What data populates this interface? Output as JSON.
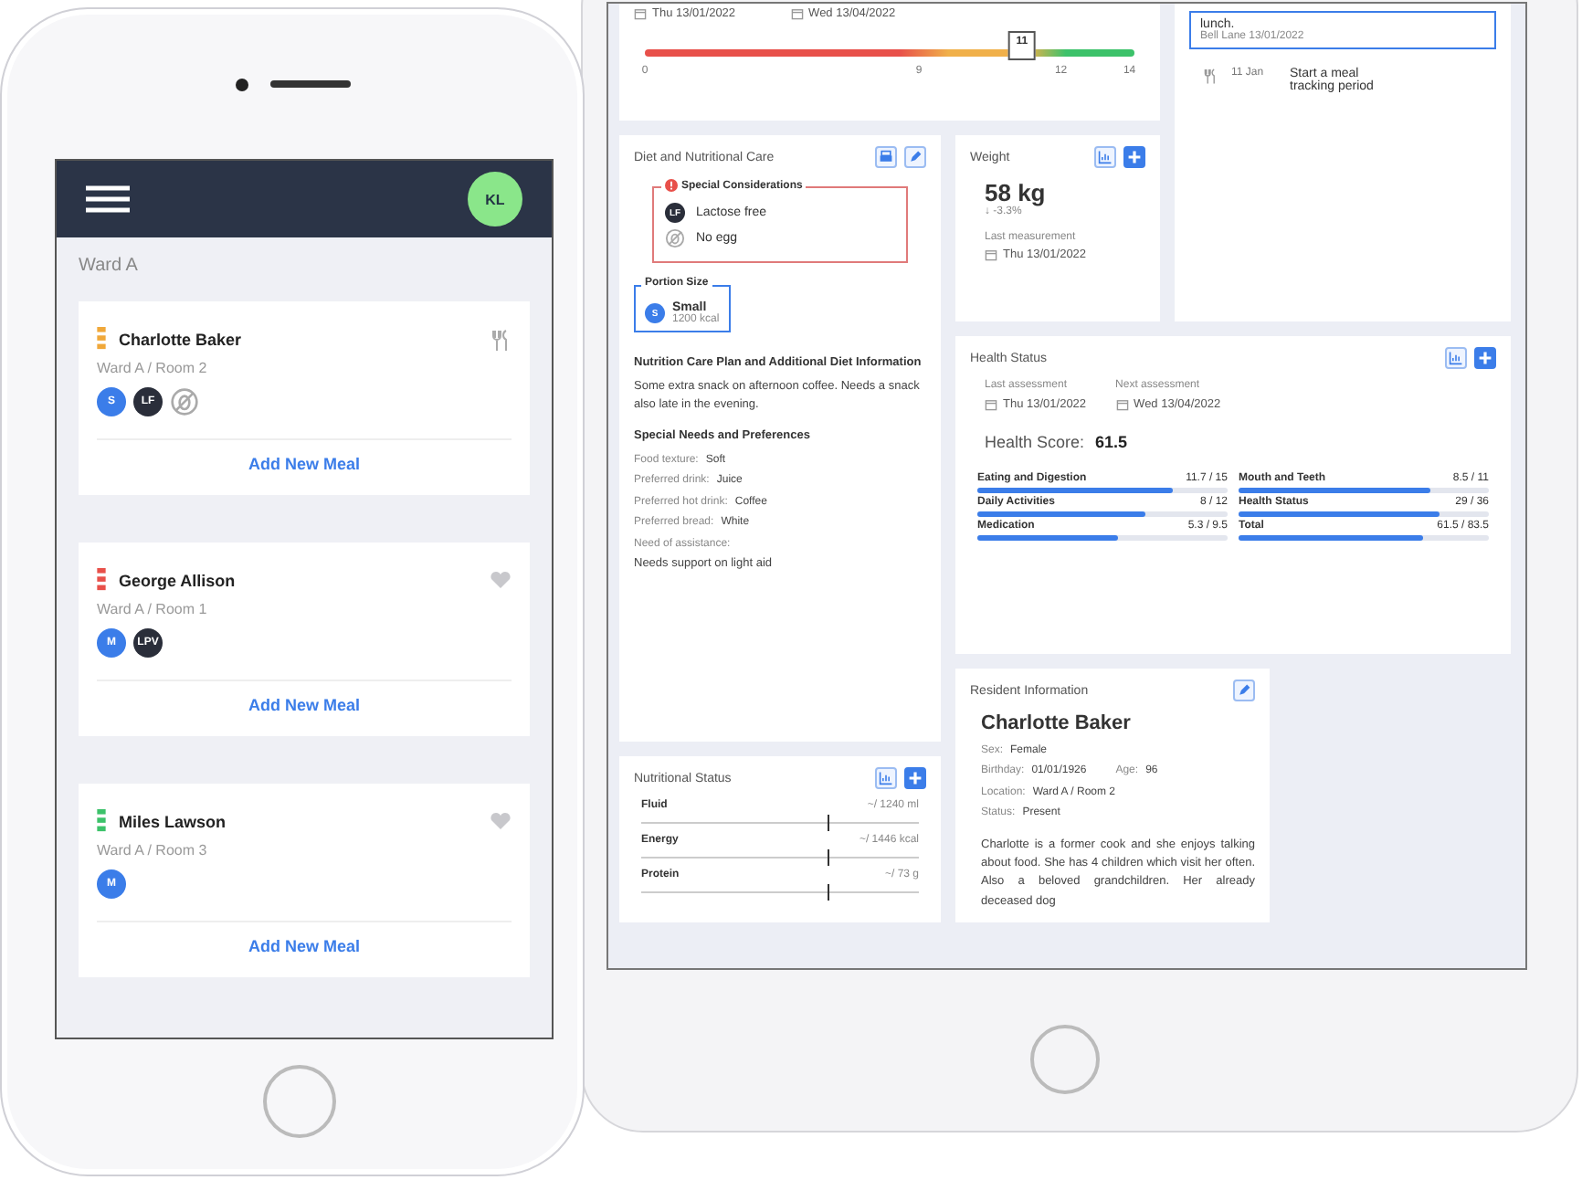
{
  "phone": {
    "avatar": "KL",
    "ward": "Ward A",
    "residents": [
      {
        "name": "Charlotte Baker",
        "location": "Ward A / Room 2",
        "color": "#f0a83a",
        "kind": "meal",
        "badges": [
          {
            "kind": "letter",
            "text": "S",
            "color": "#3b7de9"
          },
          {
            "kind": "letter",
            "text": "LF",
            "color": "#2a2e3a"
          },
          {
            "kind": "no-egg"
          }
        ],
        "action": "Add New Meal"
      },
      {
        "name": "George Allison",
        "location": "Ward A / Room 1",
        "color": "#e8504a",
        "kind": "heart",
        "badges": [
          {
            "kind": "letter",
            "text": "M",
            "color": "#3b7de9"
          },
          {
            "kind": "letter",
            "text": "LPV",
            "color": "#2a2e3a"
          }
        ],
        "action": "Add New Meal"
      },
      {
        "name": "Miles Lawson",
        "location": "Ward A / Room 3",
        "color": "#3cc26a",
        "kind": "heart",
        "badges": [
          {
            "kind": "letter",
            "text": "M",
            "color": "#3b7de9"
          }
        ],
        "action": "Add New Meal"
      }
    ]
  },
  "tablet": {
    "score_card": {
      "dates": [
        "Thu 13/01/2022",
        "Wed 13/04/2022"
      ],
      "value": "11",
      "level": 0.77,
      "ticks": [
        "0",
        "9",
        "12",
        "14"
      ]
    },
    "timeline": {
      "note": "lunch.",
      "note_meta": "Bell Lane 13/01/2022",
      "items": [
        {
          "date": "11 Jan",
          "text": "Start a meal tracking period"
        }
      ]
    },
    "diet": {
      "title": "Diet and Nutritional Care",
      "special_title": "Special Considerations",
      "special_items": [
        {
          "kind": "letter",
          "badge": "LF",
          "text": "Lactose free"
        },
        {
          "kind": "no-egg",
          "text": "No egg"
        }
      ],
      "portion_title": "Portion Size",
      "portion_badge": "S",
      "portion": "Small",
      "portion_kcal": "1200 kcal",
      "plan_title": "Nutrition Care Plan and Additional Diet Information",
      "plan_text": "Some extra snack on afternoon coffee. Needs a snack also late in the evening.",
      "needs_title": "Special Needs and Preferences",
      "needs": [
        {
          "label": "Food texture:",
          "value": "Soft"
        },
        {
          "label": "Preferred drink:",
          "value": "Juice"
        },
        {
          "label": "Preferred hot drink:",
          "value": "Coffee"
        },
        {
          "label": "Preferred bread:",
          "value": "White"
        },
        {
          "label": "Need of assistance:"
        }
      ],
      "needs_note": "Needs support on light aid"
    },
    "weight": {
      "title": "Weight",
      "value": "58 kg",
      "change": "↓ -3.3%",
      "last_label": "Last measurement",
      "last_date": "Thu 13/01/2022"
    },
    "health": {
      "title": "Health Status",
      "last_label": "Last assessment",
      "last_date": "Thu 13/01/2022",
      "next_label": "Next assessment",
      "next_date": "Wed 13/04/2022",
      "score_label": "Health Score:",
      "score": "61.5",
      "metrics": [
        {
          "name": "Eating and Digestion",
          "value": "11.7 / 15",
          "level": 0.78
        },
        {
          "name": "Mouth and Teeth",
          "value": "8.5 / 11",
          "level": 0.77
        },
        {
          "name": "Daily Activities",
          "value": "8 / 12",
          "level": 0.67
        },
        {
          "name": "Health Status",
          "value": "29 / 36",
          "level": 0.8
        },
        {
          "name": "Medication",
          "value": "5.3 / 9.5",
          "level": 0.56
        },
        {
          "name": "Total",
          "value": "61.5 / 83.5",
          "level": 0.74
        }
      ]
    },
    "nutrition": {
      "title": "Nutritional Status",
      "rows": [
        {
          "name": "Fluid",
          "value": "~/ 1240 ml",
          "level": 0.67
        },
        {
          "name": "Energy",
          "value": "~/ 1446 kcal",
          "level": 0.67
        },
        {
          "name": "Protein",
          "value": "~/ 73 g",
          "level": 0.67
        }
      ]
    },
    "resident": {
      "title": "Resident Information",
      "name": "Charlotte Baker",
      "fields": [
        {
          "label": "Sex:",
          "value": "Female"
        },
        {
          "label": "Birthday:",
          "value": "01/01/1926",
          "extra_label": "Age:",
          "extra_value": "96"
        },
        {
          "label": "Location:",
          "value": "Ward A / Room 2"
        },
        {
          "label": "Status:",
          "value": "Present"
        }
      ],
      "bio": "Charlotte is a former cook and she enjoys talking about food. She has 4 children which visit her often. Also a beloved grandchildren. Her already deceased dog"
    }
  }
}
